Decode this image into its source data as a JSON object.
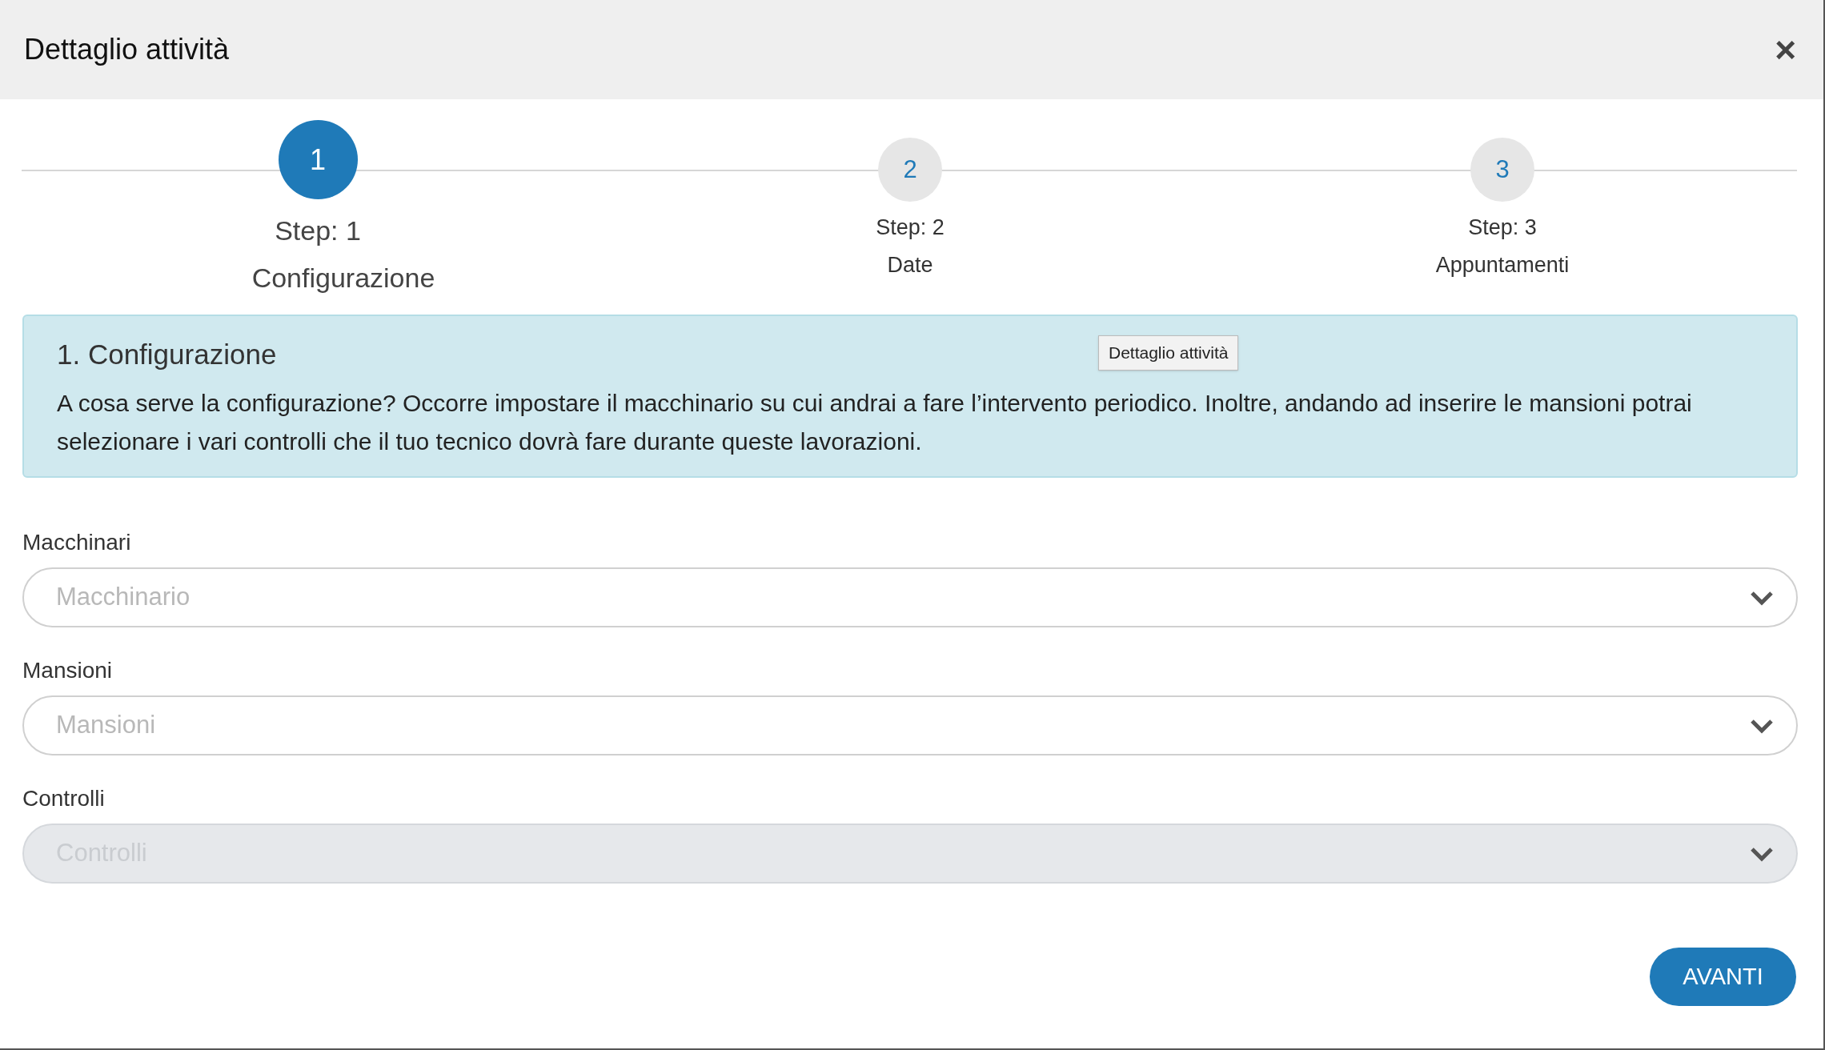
{
  "window": {
    "title": "Dettaglio attività",
    "close": "×"
  },
  "steps": [
    {
      "number": "1",
      "label": "Step: 1",
      "sublabel": "Configurazione",
      "selected": true
    },
    {
      "number": "2",
      "label": "Step: 2",
      "sublabel": "Date",
      "selected": false
    },
    {
      "number": "3",
      "label": "Step: 3",
      "sublabel": "Appuntamenti",
      "selected": false
    }
  ],
  "info": {
    "title": "1. Configurazione",
    "text": "A cosa serve la configurazione? Occorre impostare il macchinario su cui andrai a fare l’intervento periodico. Inoltre, andando ad inserire le mansioni potrai selezionare i vari controlli che il tuo tecnico dovrà fare durante queste lavorazioni.",
    "tooltip": "Dettaglio attività"
  },
  "fields": [
    {
      "label": "Macchinari",
      "placeholder": "Macchinario",
      "disabled": false
    },
    {
      "label": "Mansioni",
      "placeholder": "Mansioni",
      "disabled": false
    },
    {
      "label": "Controlli",
      "placeholder": "Controlli",
      "disabled": true
    }
  ],
  "next_button": "AVANTI"
}
